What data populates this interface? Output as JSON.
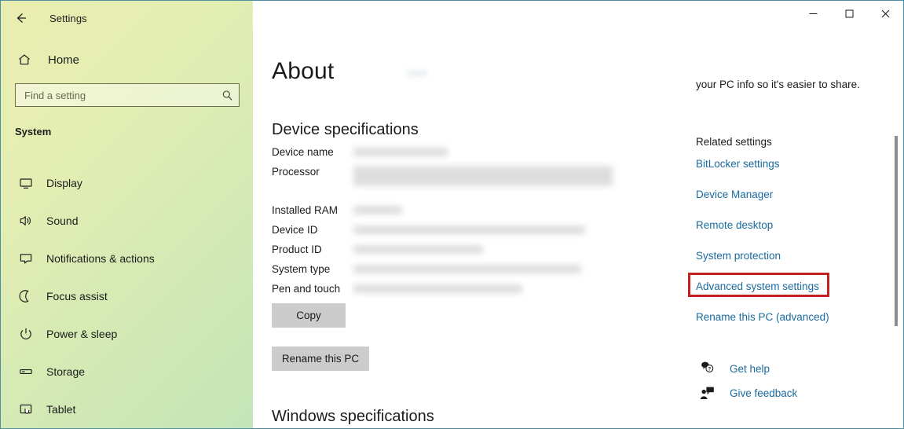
{
  "window": {
    "app_title": "Settings",
    "back_icon": "back-arrow-icon",
    "minimize_label": "—",
    "maximize_label": "☐",
    "close_label": "✕"
  },
  "sidebar": {
    "home_label": "Home",
    "home_icon": "home-icon",
    "search": {
      "placeholder": "Find a setting",
      "value": "",
      "icon": "search-icon"
    },
    "section_label": "System",
    "items": [
      {
        "label": "Display",
        "icon": "monitor-icon"
      },
      {
        "label": "Sound",
        "icon": "speaker-icon"
      },
      {
        "label": "Notifications & actions",
        "icon": "chat-bubble-icon"
      },
      {
        "label": "Focus assist",
        "icon": "moon-icon"
      },
      {
        "label": "Power & sleep",
        "icon": "power-icon"
      },
      {
        "label": "Storage",
        "icon": "drive-icon"
      },
      {
        "label": "Tablet",
        "icon": "tablet-icon"
      }
    ]
  },
  "main": {
    "page_title": "About",
    "device_specs_heading": "Device specifications",
    "specs": [
      {
        "label": "Device name",
        "value_redacted": true,
        "value_width": 120,
        "lines": 1
      },
      {
        "label": "Processor",
        "value_redacted": true,
        "value_width": 330,
        "lines": 2
      },
      {
        "label": "Installed RAM",
        "value_redacted": true,
        "value_width": 62,
        "lines": 1
      },
      {
        "label": "Device ID",
        "value_redacted": true,
        "value_width": 295,
        "lines": 1
      },
      {
        "label": "Product ID",
        "value_redacted": true,
        "value_width": 165,
        "lines": 1
      },
      {
        "label": "System type",
        "value_redacted": true,
        "value_width": 290,
        "lines": 1
      },
      {
        "label": "Pen and touch",
        "value_redacted": true,
        "value_width": 215,
        "lines": 1
      }
    ],
    "copy_button": "Copy",
    "rename_button": "Rename this PC",
    "windows_specs_heading": "Windows specifications"
  },
  "right_column": {
    "intro_text": "your PC info so it's easier to share.",
    "related_settings_heading": "Related settings",
    "links": [
      {
        "label": "BitLocker settings",
        "highlighted": false
      },
      {
        "label": "Device Manager",
        "highlighted": false
      },
      {
        "label": "Remote desktop",
        "highlighted": false
      },
      {
        "label": "System protection",
        "highlighted": false
      },
      {
        "label": "Advanced system settings",
        "highlighted": true
      },
      {
        "label": "Rename this PC (advanced)",
        "highlighted": false
      }
    ],
    "helpers": [
      {
        "label": "Get help",
        "icon": "help-bubble-icon"
      },
      {
        "label": "Give feedback",
        "icon": "feedback-person-icon"
      }
    ]
  },
  "colors": {
    "link": "#1a6a9e",
    "highlight_border": "#c32020",
    "window_border": "#4a90a4",
    "button_face": "#cccccc"
  },
  "scrollbar": {
    "thumb_color": "#8d8d8d"
  }
}
